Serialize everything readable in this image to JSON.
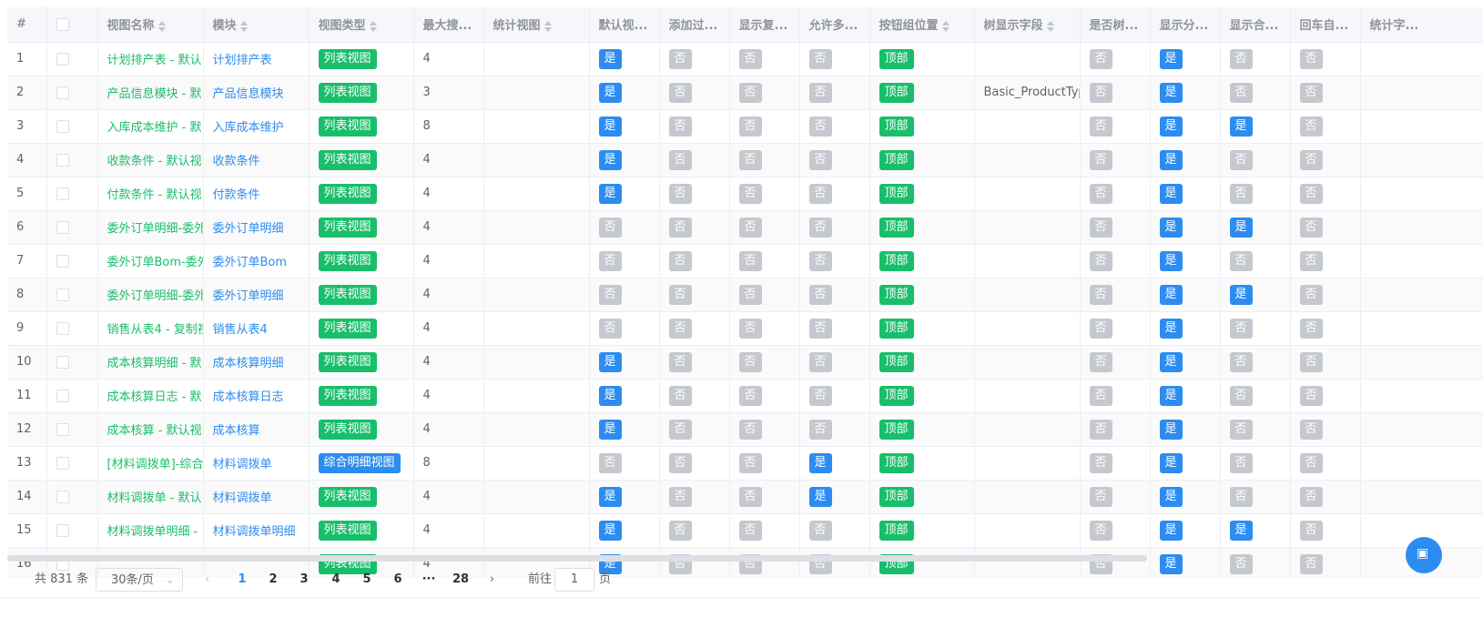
{
  "table": {
    "columns": [
      {
        "key": "idx",
        "label": "#",
        "sortable": false
      },
      {
        "key": "check",
        "label": "",
        "sortable": false
      },
      {
        "key": "name",
        "label": "视图名称",
        "sortable": true
      },
      {
        "key": "module",
        "label": "模块",
        "sortable": true
      },
      {
        "key": "type",
        "label": "视图类型",
        "sortable": true
      },
      {
        "key": "maxsearch",
        "label": "最大搜...",
        "sortable": false
      },
      {
        "key": "statview",
        "label": "统计视图",
        "sortable": true
      },
      {
        "key": "default",
        "label": "默认视...",
        "sortable": false
      },
      {
        "key": "addfilter",
        "label": "添加过...",
        "sortable": false
      },
      {
        "key": "showcopy",
        "label": "显示复...",
        "sortable": false
      },
      {
        "key": "allowmulti",
        "label": "允许多...",
        "sortable": false
      },
      {
        "key": "btnpos",
        "label": "按钮组位置",
        "sortable": true
      },
      {
        "key": "treefield",
        "label": "树显示字段",
        "sortable": true
      },
      {
        "key": "istree",
        "label": "是否树...",
        "sortable": false
      },
      {
        "key": "showsplit",
        "label": "显示分...",
        "sortable": false
      },
      {
        "key": "showtotal",
        "label": "显示合...",
        "sortable": false
      },
      {
        "key": "enterauto",
        "label": "回车自...",
        "sortable": false
      },
      {
        "key": "statfield",
        "label": "统计字...",
        "sortable": false
      }
    ],
    "rows": [
      {
        "idx": "1",
        "name": "计划排产表 - 默认",
        "module": "计划排产表",
        "type": "列表视图",
        "maxsearch": "4",
        "statview": "",
        "default": "是",
        "addfilter": "否",
        "showcopy": "否",
        "allowmulti": "否",
        "btnpos": "顶部",
        "treefield": "",
        "istree": "否",
        "showsplit": "是",
        "showtotal": "否",
        "enterauto": "否"
      },
      {
        "idx": "2",
        "name": "产品信息模块 - 默",
        "module": "产品信息模块",
        "type": "列表视图",
        "maxsearch": "3",
        "statview": "",
        "default": "是",
        "addfilter": "否",
        "showcopy": "否",
        "allowmulti": "否",
        "btnpos": "顶部",
        "treefield": "Basic_ProductType",
        "istree": "否",
        "showsplit": "是",
        "showtotal": "否",
        "enterauto": "否"
      },
      {
        "idx": "3",
        "name": "入库成本维护 - 默",
        "module": "入库成本维护",
        "type": "列表视图",
        "maxsearch": "8",
        "statview": "",
        "default": "是",
        "addfilter": "否",
        "showcopy": "否",
        "allowmulti": "否",
        "btnpos": "顶部",
        "treefield": "",
        "istree": "否",
        "showsplit": "是",
        "showtotal": "是",
        "enterauto": "否"
      },
      {
        "idx": "4",
        "name": "收款条件 - 默认视",
        "module": "收款条件",
        "type": "列表视图",
        "maxsearch": "4",
        "statview": "",
        "default": "是",
        "addfilter": "否",
        "showcopy": "否",
        "allowmulti": "否",
        "btnpos": "顶部",
        "treefield": "",
        "istree": "否",
        "showsplit": "是",
        "showtotal": "否",
        "enterauto": "否"
      },
      {
        "idx": "5",
        "name": "付款条件 - 默认视",
        "module": "付款条件",
        "type": "列表视图",
        "maxsearch": "4",
        "statview": "",
        "default": "是",
        "addfilter": "否",
        "showcopy": "否",
        "allowmulti": "否",
        "btnpos": "顶部",
        "treefield": "",
        "istree": "否",
        "showsplit": "是",
        "showtotal": "否",
        "enterauto": "否"
      },
      {
        "idx": "6",
        "name": "委外订单明细-委外",
        "module": "委外订单明细",
        "type": "列表视图",
        "maxsearch": "4",
        "statview": "",
        "default": "否",
        "addfilter": "否",
        "showcopy": "否",
        "allowmulti": "否",
        "btnpos": "顶部",
        "treefield": "",
        "istree": "否",
        "showsplit": "是",
        "showtotal": "是",
        "enterauto": "否"
      },
      {
        "idx": "7",
        "name": "委外订单Bom-委外",
        "module": "委外订单Bom",
        "type": "列表视图",
        "maxsearch": "4",
        "statview": "",
        "default": "否",
        "addfilter": "否",
        "showcopy": "否",
        "allowmulti": "否",
        "btnpos": "顶部",
        "treefield": "",
        "istree": "否",
        "showsplit": "是",
        "showtotal": "否",
        "enterauto": "否"
      },
      {
        "idx": "8",
        "name": "委外订单明细-委外",
        "module": "委外订单明细",
        "type": "列表视图",
        "maxsearch": "4",
        "statview": "",
        "default": "否",
        "addfilter": "否",
        "showcopy": "否",
        "allowmulti": "否",
        "btnpos": "顶部",
        "treefield": "",
        "istree": "否",
        "showsplit": "是",
        "showtotal": "是",
        "enterauto": "否"
      },
      {
        "idx": "9",
        "name": "销售从表4 - 复制视",
        "module": "销售从表4",
        "type": "列表视图",
        "maxsearch": "4",
        "statview": "",
        "default": "否",
        "addfilter": "否",
        "showcopy": "否",
        "allowmulti": "否",
        "btnpos": "顶部",
        "treefield": "",
        "istree": "否",
        "showsplit": "是",
        "showtotal": "否",
        "enterauto": "否"
      },
      {
        "idx": "10",
        "name": "成本核算明细 - 默",
        "module": "成本核算明细",
        "type": "列表视图",
        "maxsearch": "4",
        "statview": "",
        "default": "是",
        "addfilter": "否",
        "showcopy": "否",
        "allowmulti": "否",
        "btnpos": "顶部",
        "treefield": "",
        "istree": "否",
        "showsplit": "是",
        "showtotal": "否",
        "enterauto": "否"
      },
      {
        "idx": "11",
        "name": "成本核算日志 - 默",
        "module": "成本核算日志",
        "type": "列表视图",
        "maxsearch": "4",
        "statview": "",
        "default": "是",
        "addfilter": "否",
        "showcopy": "否",
        "allowmulti": "否",
        "btnpos": "顶部",
        "treefield": "",
        "istree": "否",
        "showsplit": "是",
        "showtotal": "否",
        "enterauto": "否"
      },
      {
        "idx": "12",
        "name": "成本核算 - 默认视",
        "module": "成本核算",
        "type": "列表视图",
        "maxsearch": "4",
        "statview": "",
        "default": "是",
        "addfilter": "否",
        "showcopy": "否",
        "allowmulti": "否",
        "btnpos": "顶部",
        "treefield": "",
        "istree": "否",
        "showsplit": "是",
        "showtotal": "否",
        "enterauto": "否"
      },
      {
        "idx": "13",
        "name": "[材料调拨单]-综合",
        "module": "材料调拨单",
        "type": "综合明细视图",
        "maxsearch": "8",
        "statview": "",
        "default": "否",
        "addfilter": "否",
        "showcopy": "否",
        "allowmulti": "是",
        "btnpos": "顶部",
        "treefield": "",
        "istree": "否",
        "showsplit": "是",
        "showtotal": "否",
        "enterauto": "否"
      },
      {
        "idx": "14",
        "name": "材料调拨单 - 默认",
        "module": "材料调拨单",
        "type": "列表视图",
        "maxsearch": "4",
        "statview": "",
        "default": "是",
        "addfilter": "否",
        "showcopy": "否",
        "allowmulti": "是",
        "btnpos": "顶部",
        "treefield": "",
        "istree": "否",
        "showsplit": "是",
        "showtotal": "否",
        "enterauto": "否"
      },
      {
        "idx": "15",
        "name": "材料调拨单明细 -",
        "module": "材料调拨单明细",
        "type": "列表视图",
        "maxsearch": "4",
        "statview": "",
        "default": "是",
        "addfilter": "否",
        "showcopy": "否",
        "allowmulti": "否",
        "btnpos": "顶部",
        "treefield": "",
        "istree": "否",
        "showsplit": "是",
        "showtotal": "是",
        "enterauto": "否"
      },
      {
        "idx": "16",
        "name": "",
        "module": "",
        "type": "列表视图",
        "maxsearch": "4",
        "statview": "",
        "default": "是",
        "addfilter": "否",
        "showcopy": "否",
        "allowmulti": "否",
        "btnpos": "顶部",
        "treefield": "",
        "istree": "否",
        "showsplit": "是",
        "showtotal": "否",
        "enterauto": "否"
      }
    ]
  },
  "pagination": {
    "total_text": "共 831 条",
    "page_size": "30条/页",
    "prev_icon": "chevron-left-icon",
    "pages": [
      "1",
      "2",
      "3",
      "4",
      "5",
      "6",
      "···",
      "28"
    ],
    "active_page": "1",
    "next_icon": "chevron-right-icon",
    "goto_label": "前往",
    "goto_value": "1",
    "page_suffix": "页"
  },
  "colors": {
    "green": "#19be6b",
    "blue": "#2d8cf0",
    "gray": "#c5c8ce"
  }
}
